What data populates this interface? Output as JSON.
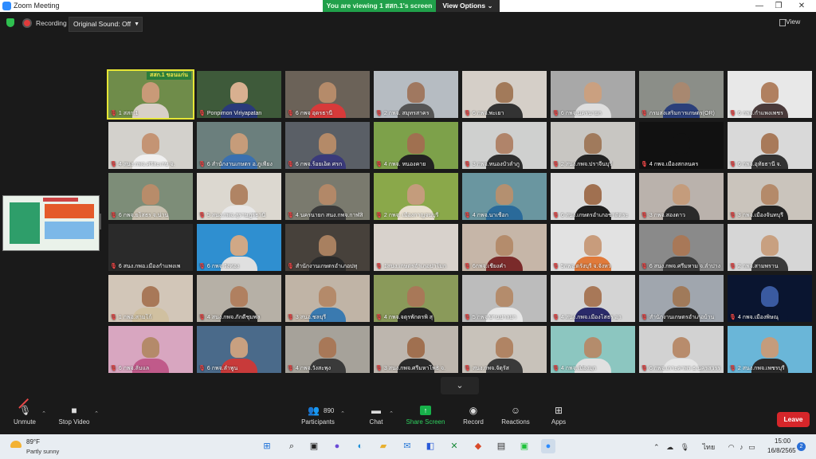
{
  "titlebar": {
    "title": "Zoom Meeting",
    "viewing": "You are viewing 1 สสก.1's screen",
    "view_options": "View Options"
  },
  "recbar": {
    "recording": "Recording",
    "original_sound": "Original Sound: Off",
    "view": "View"
  },
  "grid": {
    "tiles": [
      {
        "name": "1 สสก.1",
        "active": true,
        "banner": "สสก.1 ขอนแก่น",
        "bg": "#6f8c4a",
        "skin": "#c99a78",
        "shirt": "#d8d0c8"
      },
      {
        "name": "Ponpimon Viriyapatan",
        "bg": "#3e5a3a",
        "skin": "#d8b090",
        "shirt": "#2a3a7a"
      },
      {
        "name": "6 กพจ อุดรธานี",
        "bg": "#6b6258",
        "skin": "#b58b6a",
        "shirt": "#d73a3a"
      },
      {
        "name": "2 กพจ. สมุทรสาคร",
        "bg": "#b6bcc2",
        "skin": "#a07860",
        "shirt": "#555"
      },
      {
        "name": "6 กพจ.พะเยา",
        "bg": "#d5cfc8",
        "skin": "#a27a5a",
        "shirt": "#333"
      },
      {
        "name": "6 กพจ.นครนายก",
        "bg": "#a8a8a8",
        "skin": "#caa080",
        "shirt": "#dedede"
      },
      {
        "name": "กรมส่งเสริมการเกษตร(OR)",
        "bg": "#8b8e88",
        "skin": "#a88870",
        "shirt": "#2b3f7a"
      },
      {
        "name": "6 กพจ.กำแพงเพชร",
        "bg": "#e8e8e8",
        "skin": "#b08060",
        "shirt": "#4a3a3a"
      },
      {
        "name": "4 สนง.กพจ.ศรีสะเกษ จ.",
        "bg": "#d3d1cc",
        "skin": "#c49474",
        "shirt": "#f0f0f0"
      },
      {
        "name": "6 สำนักงานเกษตร อ.ภูเพียง",
        "bg": "#6b7f7d",
        "skin": "#c69c7a",
        "shirt": "#3a70b0"
      },
      {
        "name": "6 กพจ.ร้อยเอ็ด ศรก",
        "bg": "#5a5f66",
        "skin": "#b48a68",
        "shirt": "#3a3a7a"
      },
      {
        "name": "4 กพจ. หนองคาย",
        "bg": "#7da14a",
        "skin": "#a07050",
        "shirt": "#222"
      },
      {
        "name": "3 กพจ.หนองบัวลำภู",
        "bg": "#cfd0cf",
        "skin": "#b0846a",
        "shirt": "#2e2e2e"
      },
      {
        "name": "2 สนง.กพจ.ปราจีนบุรี",
        "bg": "#c8c6c2",
        "skin": "#a07a5c",
        "shirt": "#222"
      },
      {
        "name": "4 กพจ.เมืองสกลนคร",
        "bg": "#111111",
        "skin": "#111111",
        "shirt": "#111111"
      },
      {
        "name": "6 กพจ.อุทัยธานี จ.",
        "bg": "#d9d9d9",
        "skin": "#a87a5a",
        "shirt": "#333"
      },
      {
        "name": "6 กพจ.ยโสธร จ.น่าน",
        "bg": "#7d8d78",
        "skin": "#b88c6a",
        "shirt": "#c8c0b0"
      },
      {
        "name": "5 สนง.กพจ.สุราษฎร์ธานี",
        "bg": "#dcd8d0",
        "skin": "#b08464",
        "shirt": "#e8e8e8"
      },
      {
        "name": "4 นครนายก สนง.กพจ.กาฬสิ",
        "bg": "#7a7a6e",
        "skin": "#b28868",
        "shirt": "#3a3a3a"
      },
      {
        "name": "2 กพจ. เมืองกาญจนบุรี",
        "bg": "#8aa84a",
        "skin": "#c49c7c",
        "shirt": "#e8e0d0"
      },
      {
        "name": "4 กพจ.นาเชือก",
        "bg": "#6a96a0",
        "skin": "#b49070",
        "shirt": "#2a6a9a"
      },
      {
        "name": "6 สนง.เกษตรอำเภอชาติตระ",
        "bg": "#dcdcdc",
        "skin": "#a07050",
        "shirt": "#1e1e1e"
      },
      {
        "name": "3 กพจ.สองดาว",
        "bg": "#bab2ac",
        "skin": "#c49c7c",
        "shirt": "#2a2a2a"
      },
      {
        "name": "3 กพจ.เมืองจันทบุรี",
        "bg": "#cac4bc",
        "skin": "#b48a6a",
        "shirt": "#222"
      },
      {
        "name": "6 สนง.กพอ.เมืองกำแพงเพ",
        "bg": "#2a2a2a",
        "skin": "#2a2a2a",
        "shirt": "#2a2a2a"
      },
      {
        "name": "6 กพจ.วังทอง",
        "bg": "#2f8fd0",
        "skin": "#d0a886",
        "shirt": "#e0e0e0"
      },
      {
        "name": "สำนักงานเกษตรอำเภอปทุ",
        "bg": "#47413b",
        "skin": "#a88060",
        "shirt": "#2a2a2a"
      },
      {
        "name": "1สนง.เกษตรอำเภอปาโมก",
        "bg": "#d8d2cc",
        "skin": "#d8d2cc",
        "shirt": "#d8d2cc"
      },
      {
        "name": "6กพจ.เชียงคำ",
        "bg": "#c6b6a8",
        "skin": "#b48c6c",
        "shirt": "#7a2a2a"
      },
      {
        "name": "5กพจ.ตรังบุรี จ.จังหว",
        "bg": "#e2e2e2",
        "skin": "#c89c7c",
        "shirt": "#e07a3a"
      },
      {
        "name": "6 สนง.กพจ.ศรีมหาม จ.ลำปาง",
        "bg": "#8a8a8a",
        "skin": "#a87858",
        "shirt": "#3a3a3a"
      },
      {
        "name": "2 กพจ.สามพราน",
        "bg": "#d6d6d6",
        "skin": "#c8a080",
        "shirt": "#3a3a3a"
      },
      {
        "name": "1 กพอ.สามโก้",
        "bg": "#d2c6b8",
        "skin": "#a87858",
        "shirt": "#d0c0a0"
      },
      {
        "name": "4 สนง.กพจ.ภักดีชุมพล",
        "bg": "#b6b0a6",
        "skin": "#b08060",
        "shirt": "#222"
      },
      {
        "name": "3 สนอ.ชลบุรี",
        "bg": "#c0b4a6",
        "skin": "#b48a6a",
        "shirt": "#3a7ab0"
      },
      {
        "name": "4 กพจ.จตุรพักตรพิ สุ",
        "bg": "#8a9a5a",
        "skin": "#a87858",
        "shirt": "#222"
      },
      {
        "name": "5 กพจ.บ้านปาลม่า",
        "bg": "#bcbcbc",
        "skin": "#b48c6c",
        "shirt": "#e8e8e8"
      },
      {
        "name": "4 สนง.กพจ.เมืองโสธร อา",
        "bg": "#d4d4d4",
        "skin": "#a87858",
        "shirt": "#2a2a6a"
      },
      {
        "name": "สำนักงานเกษตรอำเภอบ้าน",
        "bg": "#a0a6ae",
        "skin": "#a07a5a",
        "shirt": "#2a2a2a"
      },
      {
        "name": "4 กพจ.เมืองพิษณุ",
        "bg": "#0a1530",
        "skin": "#3a5aa0",
        "shirt": "#0a1530"
      },
      {
        "name": "6 กพจ.ลับแล",
        "bg": "#d8a6c0",
        "skin": "#b48a6a",
        "shirt": "#c05a8a"
      },
      {
        "name": "6 กพจ.ลำพูน",
        "bg": "#4a6a8a",
        "skin": "#c8a080",
        "shirt": "#c83a3a"
      },
      {
        "name": "4 กพจ.วังสะพุง",
        "bg": "#a6a29a",
        "skin": "#a87858",
        "shirt": "#3a3a3a"
      },
      {
        "name": "3 สนง.กพจ.ศรีมหาโพธิ จ.",
        "bg": "#bdb6ae",
        "skin": "#a07050",
        "shirt": "#2a2a2a"
      },
      {
        "name": "สนง.กพจ.จัตุรัส",
        "bg": "#c8c2ba",
        "skin": "#b08464",
        "shirt": "#3a3a3a"
      },
      {
        "name": "4 กพจ.เมืองมุก",
        "bg": "#8cc6c0",
        "skin": "#b48c6c",
        "shirt": "#e0e0e0"
      },
      {
        "name": "6 กพจ.เกาะคาพร ธ.นครสวรร",
        "bg": "#d2d2d2",
        "skin": "#b88c6c",
        "shirt": "#e6e6e6"
      },
      {
        "name": "2 สนง.กพจ.เพชรบุรี",
        "bg": "#6ab6d8",
        "skin": "#c49c7c",
        "shirt": "#2a2a2a"
      }
    ]
  },
  "toolbar": {
    "unmute": "Unmute",
    "stop_video": "Stop Video",
    "participants": "Participants",
    "participants_count": "890",
    "chat": "Chat",
    "share_screen": "Share Screen",
    "record": "Record",
    "reactions": "Reactions",
    "apps": "Apps",
    "leave": "Leave"
  },
  "taskbar": {
    "weather_temp": "89°F",
    "weather_desc": "Partly sunny",
    "lang": "ไทย",
    "time": "15:00",
    "date": "16/8/2565",
    "notifications": "2"
  },
  "colors": {
    "share_green": "#17b24a",
    "leave_red": "#d6262a",
    "banner_green": "#20a04a",
    "active_outline": "#e6e635"
  }
}
